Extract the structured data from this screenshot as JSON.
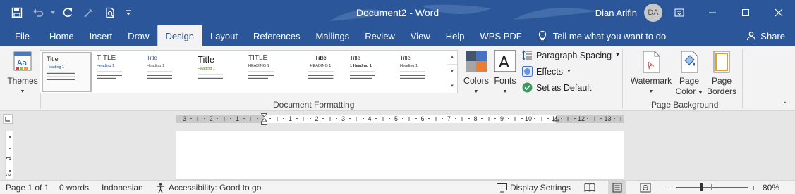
{
  "title_bar": {
    "document_title": "Document2 - Word",
    "user_name": "Dian Arifin",
    "user_initials": "DA"
  },
  "tabs": [
    {
      "label": "File"
    },
    {
      "label": "Home"
    },
    {
      "label": "Insert"
    },
    {
      "label": "Draw"
    },
    {
      "label": "Design",
      "active": true
    },
    {
      "label": "Layout"
    },
    {
      "label": "References"
    },
    {
      "label": "Mailings"
    },
    {
      "label": "Review"
    },
    {
      "label": "View"
    },
    {
      "label": "Help"
    },
    {
      "label": "WPS PDF"
    }
  ],
  "tell_me": "Tell me what you want to do",
  "share": "Share",
  "ribbon": {
    "themes_label": "Themes",
    "style_sets": [
      {
        "title": "Title",
        "heading": "Heading 1"
      },
      {
        "title": "TITLE",
        "heading": "Heading 1"
      },
      {
        "title": "Title",
        "heading": "Heading 1"
      },
      {
        "title": "Title",
        "heading": "Heading 1"
      },
      {
        "title": "TITLE",
        "heading": "HEADING 1"
      },
      {
        "title": "Title",
        "heading": "HEADING 1"
      },
      {
        "title": "Title",
        "heading": "1   Heading 1"
      },
      {
        "title": "Title",
        "heading": "Heading 1"
      }
    ],
    "colors_label": "Colors",
    "fonts_label": "Fonts",
    "paragraph_spacing": "Paragraph Spacing",
    "effects": "Effects",
    "set_as_default": "Set as Default",
    "document_formatting": "Document Formatting",
    "watermark": "Watermark",
    "page_color_line1": "Page",
    "page_color_line2": "Color",
    "page_borders_line1": "Page",
    "page_borders_line2": "Borders",
    "page_background": "Page Background"
  },
  "status_bar": {
    "page": "Page 1 of 1",
    "words": "0 words",
    "language": "Indonesian",
    "accessibility": "Accessibility: Good to go",
    "display_settings": "Display Settings",
    "zoom_out": "−",
    "zoom_in": "+",
    "zoom": "80%"
  },
  "colors": {
    "brand": "#2b579a",
    "ribbon": "#f3f3f3",
    "canvas": "#e6e6e6"
  }
}
